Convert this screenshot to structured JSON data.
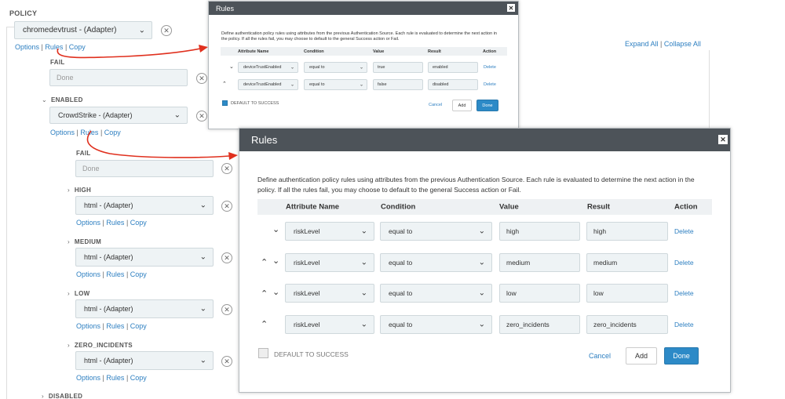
{
  "policy": {
    "heading": "POLICY",
    "root_adapter": "chromedevtrust - (Adapter)",
    "expand_all": "Expand All",
    "collapse_all": "Collapse All",
    "links": {
      "options": "Options",
      "rules": "Rules",
      "copy": "Copy",
      "sep": "|"
    },
    "fail_label": "FAIL",
    "fail_value": "Done",
    "enabled_label": "ENABLED",
    "enabled_adapter": "CrowdStrike - (Adapter)",
    "nested_fail_label": "FAIL",
    "nested_fail_value": "Done",
    "branches": [
      {
        "label": "HIGH",
        "adapter": "html - (Adapter)"
      },
      {
        "label": "MEDIUM",
        "adapter": "html - (Adapter)"
      },
      {
        "label": "LOW",
        "adapter": "html - (Adapter)"
      },
      {
        "label": "ZERO_INCIDENTS",
        "adapter": "html - (Adapter)"
      }
    ],
    "disabled_label": "DISABLED"
  },
  "small_modal": {
    "title": "Rules",
    "description": "Define authentication policy rules using attributes from the previous Authentication Source. Each rule is evaluated to determine the next action in the policy. If all the rules fail, you may choose to default to the general Success action or Fail.",
    "columns": [
      "Attribute Name",
      "Condition",
      "Value",
      "Result",
      "Action"
    ],
    "rows": [
      {
        "attribute": "deviceTrustEnabled",
        "condition": "equal to",
        "value": "true",
        "result": "enabled",
        "action": "Delete"
      },
      {
        "attribute": "deviceTrustEnabled",
        "condition": "equal to",
        "value": "false",
        "result": "disabled",
        "action": "Delete"
      }
    ],
    "default_label": "DEFAULT TO SUCCESS",
    "cancel": "Cancel",
    "add": "Add",
    "done": "Done"
  },
  "large_modal": {
    "title": "Rules",
    "description_line1": "Define authentication policy rules using attributes from the previous Authentication Source. Each rule is evaluated to determine the next action in the",
    "description_line2": "policy. If all the rules fail, you may choose to default to the general Success action or Fail.",
    "columns": [
      "Attribute Name",
      "Condition",
      "Value",
      "Result",
      "Action"
    ],
    "rows": [
      {
        "attribute": "riskLevel",
        "condition": "equal to",
        "value": "high",
        "result": "high",
        "action": "Delete"
      },
      {
        "attribute": "riskLevel",
        "condition": "equal to",
        "value": "medium",
        "result": "medium",
        "action": "Delete"
      },
      {
        "attribute": "riskLevel",
        "condition": "equal to",
        "value": "low",
        "result": "low",
        "action": "Delete"
      },
      {
        "attribute": "riskLevel",
        "condition": "equal to",
        "value": "zero_incidents",
        "result": "zero_incidents",
        "action": "Delete"
      }
    ],
    "default_label": "DEFAULT TO SUCCESS",
    "cancel": "Cancel",
    "add": "Add",
    "done": "Done"
  },
  "colors": {
    "accent": "#2d7fc1",
    "header": "#4d5359",
    "arrow": "#e0301e",
    "done": "#2d8ac7"
  }
}
